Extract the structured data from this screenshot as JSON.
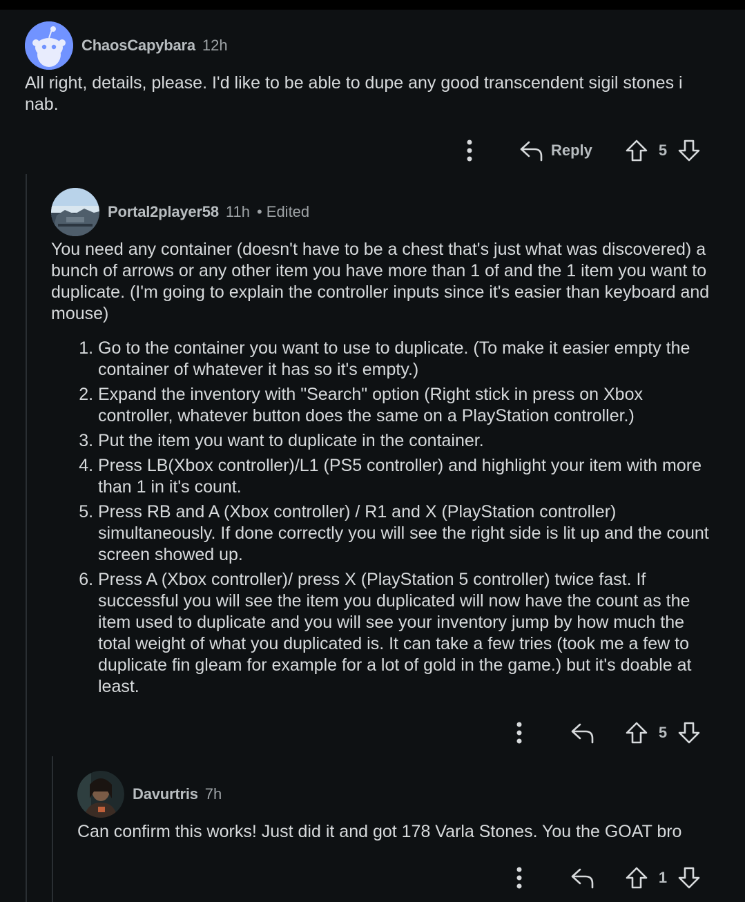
{
  "comments": [
    {
      "username": "ChaosCapybara",
      "age": "12h",
      "text": "All right, details, please. I'd like to be able to dupe any good transcendent sigil stones i nab.",
      "reply_label": "Reply",
      "score": "5"
    },
    {
      "username": "Portal2player58",
      "age": "11h",
      "edited": "• Edited",
      "intro": "You need any container (doesn't have to be a chest that's just what was discovered) a bunch of arrows or any other item you have more than 1 of and the 1 item you want to duplicate. (I'm going to explain the controller inputs since it's easier than keyboard and mouse)",
      "steps": [
        "Go to the container you want to use to duplicate. (To make it easier empty the container of whatever it has so it's empty.)",
        "Expand the inventory with \"Search\" option (Right stick in press on Xbox controller, whatever button does the same on a PlayStation controller.)",
        "Put the item you want to duplicate in the container.",
        "Press LB(Xbox controller)/L1 (PS5 controller) and highlight your item with more than 1 in it's count.",
        "Press RB and A (Xbox controller) / R1 and X (PlayStation controller) simultaneously. If done correctly you will see the right side is lit up and the count screen showed up.",
        "Press A (Xbox controller)/ press X (PlayStation 5 controller) twice fast. If successful you will see the item you duplicated will now have the count as the item used to duplicate and you will see your inventory jump by how much the total weight of what you duplicated is. It can take a few tries (took me a few to duplicate fin gleam for example for a lot of gold in the game.) but it's doable at least."
      ],
      "score": "5"
    },
    {
      "username": "Davurtris",
      "age": "7h",
      "text": "Can confirm this works! Just did it and got 178 Varla Stones. You the GOAT bro",
      "score": "1"
    }
  ],
  "colors": {
    "background": "#0e1113",
    "text": "#d7dadc",
    "meta": "#9ea3a6",
    "username": "#b8bdc0",
    "thread_line": "#2a2f33",
    "snoo_avatar_bg": "#7193ff"
  },
  "icons": [
    "snoo-avatar",
    "more-options-icon",
    "reply-arrow-icon",
    "upvote-icon",
    "downvote-icon"
  ]
}
